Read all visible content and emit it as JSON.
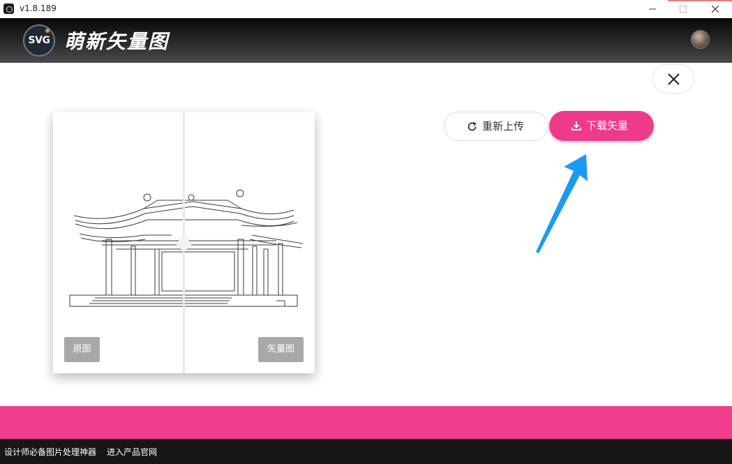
{
  "window": {
    "version": "v1.8.189",
    "icons": {
      "app": "svg-app-icon",
      "minimize": "minimize-icon",
      "maximize": "maximize-icon",
      "close": "close-icon"
    }
  },
  "header": {
    "logo_text": "SVG",
    "brand_name": "萌新矢量图",
    "avatar": "user-avatar"
  },
  "main": {
    "close_icon": "close-icon",
    "preview": {
      "original_label": "原图",
      "vector_label": "矢量图"
    },
    "actions": {
      "reupload_label": "重新上传",
      "reupload_icon": "refresh-icon",
      "download_label": "下载矢量",
      "download_icon": "download-icon"
    }
  },
  "footer": {
    "link1": "设计师必备图片处理神器",
    "link2": "进入产品官网"
  },
  "colors": {
    "accent": "#ef3a8a",
    "pink_band": "#f23d8e",
    "header_bg": "#1a1a1a",
    "footer_bg": "#171717",
    "annotation_arrow": "#1a9bf0"
  }
}
